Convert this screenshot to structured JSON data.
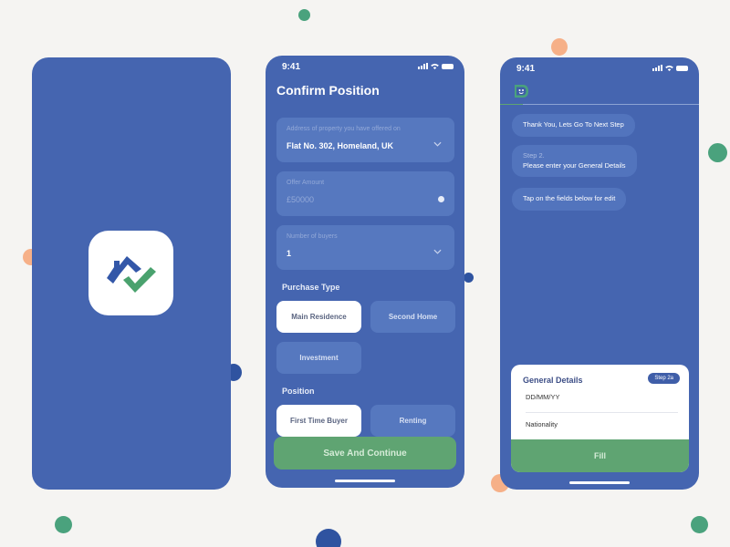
{
  "colors": {
    "background": "#f5f4f2",
    "phone_blue": "#4565b0",
    "field_blue": "#5678bf",
    "accent_green": "#5fa472",
    "accent_orange": "#f6b088",
    "dot_green": "#4aa27d",
    "dot_blue": "#2f53a0"
  },
  "splash_screen": {
    "logo": "house-check-logo"
  },
  "confirm_screen": {
    "status_time": "9:41",
    "title": "Confirm Position",
    "address_field": {
      "label": "Address of property you have offered on",
      "value": "Flat No. 302, Homeland, UK"
    },
    "offer_field": {
      "label": "Offer Amount",
      "placeholder": "£50000"
    },
    "buyers_field": {
      "label": "Number of buyers",
      "value": "1"
    },
    "purchase_type": {
      "heading": "Purchase Type",
      "options": [
        "Main Residence",
        "Second Home",
        "Investment"
      ],
      "selected": "Main Residence"
    },
    "position": {
      "heading": "Position",
      "options": [
        "First Time Buyer",
        "Renting"
      ],
      "selected": "First Time Buyer"
    },
    "save_button": "Save And Continue"
  },
  "chat_screen": {
    "status_time": "9:41",
    "messages": [
      {
        "text": "Thank You, Lets Go To Next Step"
      },
      {
        "sub": "Step 2.",
        "text": "Please enter your General Details"
      },
      {
        "text": "Tap on the fields below for edit"
      }
    ],
    "details_card": {
      "title": "General Details",
      "badge": "Step 2a",
      "fields": [
        "DD/MM/YY",
        "Nationality"
      ],
      "button": "Fill"
    }
  }
}
